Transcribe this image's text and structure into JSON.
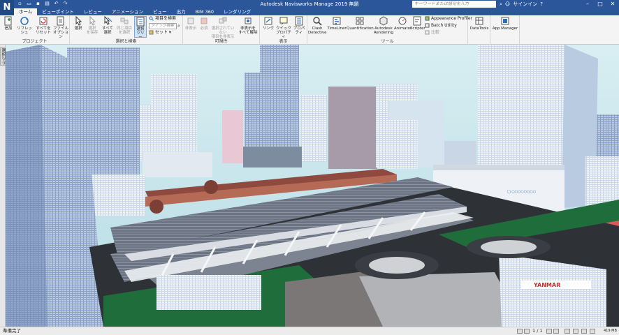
{
  "window": {
    "title": "Autodesk Navisworks Manage 2019  無題",
    "search_placeholder": "キーワードまたは語句を入力",
    "sign_in_label": "サインイン",
    "logo_letter": "N"
  },
  "tabs": [
    "ホーム",
    "ビューポイント",
    "レビュー",
    "アニメーション",
    "ビュー",
    "出力",
    "BIM 360",
    "レンダリング"
  ],
  "ribbon": {
    "project": {
      "label": "プロジェクト",
      "buttons": [
        "追加",
        "リフレッシュ",
        "すべてを\nリセット",
        "ファイル\nオプション"
      ]
    },
    "select_search": {
      "label": "選択と検索",
      "buttons": [
        "選択",
        "選択\nを保存",
        "すべて\n選択",
        "同じ項目\nを選択",
        "選択\nツリー"
      ],
      "find_items": "項目を検索",
      "quick_find_placeholder": "クイック検索",
      "sets": "セット"
    },
    "visibility": {
      "label": "可視性",
      "buttons": [
        "非表示",
        "必須",
        "選択されていない\n項目を非表示",
        "非表示を\nすべて解除"
      ]
    },
    "display": {
      "label": "表示",
      "buttons": [
        "リンク",
        "クイック\nプロパティ",
        "プロパティ"
      ]
    },
    "tools": {
      "label": "ツール",
      "buttons": [
        "Clash\nDetective",
        "TimeLiner",
        "Quantification",
        "Autodesk\nRendering",
        "Animator",
        "Scripter"
      ],
      "small": [
        "Appearance Profiler",
        "Batch Utility",
        "比較"
      ]
    },
    "datatools": "DataTools",
    "appmanager": "App Manager"
  },
  "left_panel_tab": "選択ツリー",
  "status": {
    "message": "準備完了",
    "page": "1 / 1",
    "memory": "419 MB"
  },
  "signs": {
    "billboard": "YANMAR",
    "building_sign": "□ ○○○○○○○○"
  },
  "colors": {
    "ribbon_blue": "#2b579a",
    "sky": "#bfe2ea",
    "roof": "#6e7684",
    "ground": "#1f6d3a"
  },
  "icons": [
    "add-icon",
    "refresh-icon",
    "reset-icon",
    "file-options-icon",
    "select-icon",
    "save-selection-icon",
    "select-all-icon",
    "select-same-icon",
    "selection-tree-icon",
    "find-icon",
    "hide-icon",
    "require-icon",
    "hide-unselected-icon",
    "unhide-all-icon",
    "links-icon",
    "quick-properties-icon",
    "properties-icon",
    "clash-detective-icon",
    "timeliner-icon",
    "quantification-icon",
    "rendering-icon",
    "animator-icon",
    "scripter-icon",
    "datatools-icon",
    "app-manager-icon"
  ]
}
